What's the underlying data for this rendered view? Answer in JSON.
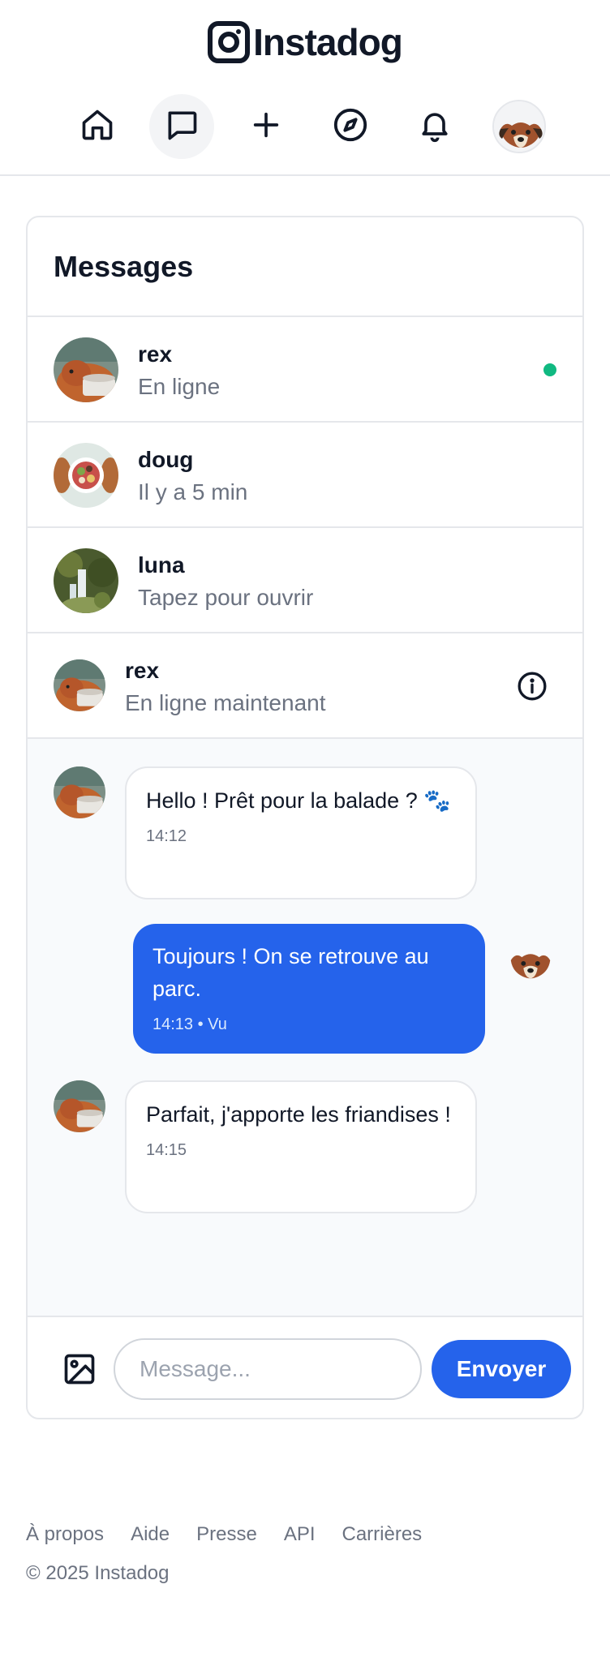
{
  "app": {
    "name": "Instadog"
  },
  "nav": {
    "items": [
      {
        "icon": "home-icon"
      },
      {
        "icon": "message-icon",
        "active": true
      },
      {
        "icon": "plus-icon"
      },
      {
        "icon": "compass-icon"
      },
      {
        "icon": "bell-icon"
      },
      {
        "icon": "profile-avatar"
      }
    ]
  },
  "messages": {
    "title": "Messages",
    "conversations": [
      {
        "name": "rex",
        "status": "En ligne",
        "online": true
      },
      {
        "name": "doug",
        "status": "Il y a 5 min",
        "online": false
      },
      {
        "name": "luna",
        "status": "Tapez pour ouvrir",
        "online": false
      }
    ]
  },
  "chat": {
    "name": "rex",
    "status": "En ligne maintenant",
    "thread": [
      {
        "from": "them",
        "text": "Hello ! Prêt pour la balade ? 🐾",
        "time": "14:12"
      },
      {
        "from": "me",
        "text": "Toujours ! On se retrouve au parc.",
        "time": "14:13 • Vu"
      },
      {
        "from": "them",
        "text": "Parfait, j'apporte les friandises !",
        "time": "14:15"
      }
    ]
  },
  "composer": {
    "placeholder": "Message...",
    "send_label": "Envoyer"
  },
  "footer": {
    "links": [
      "À propos",
      "Aide",
      "Presse",
      "API",
      "Carrières"
    ],
    "copyright": "© 2025 Instadog"
  },
  "colors": {
    "accent": "#2563eb",
    "online": "#10b981",
    "border": "#e5e7eb",
    "muted": "#6b7280"
  }
}
